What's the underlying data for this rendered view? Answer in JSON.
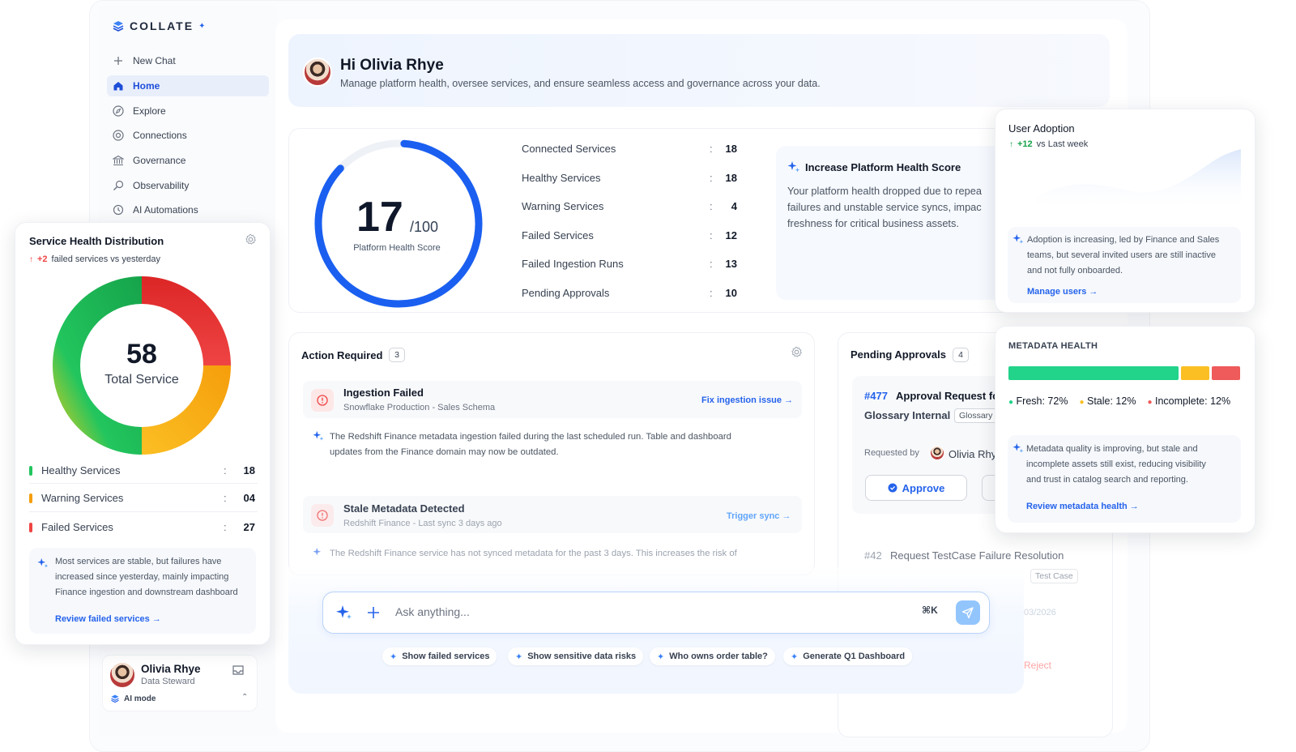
{
  "app": {
    "logo_text": "COLLATE"
  },
  "sidebar": {
    "items": [
      {
        "label": "New Chat",
        "icon": "plus-icon",
        "active": false
      },
      {
        "label": "Home",
        "icon": "home-icon",
        "active": true
      },
      {
        "label": "Explore",
        "icon": "compass-icon",
        "active": false
      },
      {
        "label": "Connections",
        "icon": "connections-icon",
        "active": false
      },
      {
        "label": "Governance",
        "icon": "governance-icon",
        "active": false
      },
      {
        "label": "Observability",
        "icon": "observability-icon",
        "active": false
      },
      {
        "label": "AI Automations",
        "icon": "automation-icon",
        "active": false
      }
    ],
    "user": {
      "name": "Olivia Rhye",
      "role": "Data Steward",
      "mode": "AI mode"
    }
  },
  "greeting": {
    "title": "Hi Olivia Rhye",
    "subtitle": "Manage platform health, oversee services, and ensure seamless access and governance across your data."
  },
  "platform_health": {
    "score": 17,
    "max_label": "/100",
    "label": "Platform Health Score",
    "stats": [
      {
        "label": "Connected Services",
        "value": "18"
      },
      {
        "label": "Healthy Services",
        "value": "18"
      },
      {
        "label": "Warning Services",
        "value": "4"
      },
      {
        "label": "Failed Services",
        "value": "12"
      },
      {
        "label": "Failed Ingestion Runs",
        "value": "13"
      },
      {
        "label": "Pending Approvals",
        "value": "10"
      }
    ],
    "insight": {
      "title": "Increase Platform Health Score",
      "lines": [
        "Your platform health dropped due to repea",
        "failures and unstable service syncs, impac",
        "freshness for critical business assets."
      ]
    }
  },
  "service_health": {
    "title": "Service Health Distribution",
    "delta": "+2",
    "delta_text": "failed services vs yesterday",
    "total": "58",
    "total_label": "Total Service",
    "segments": [
      {
        "label": "Healthy Services",
        "value": "18",
        "color": "#22c55e"
      },
      {
        "label": "Warning Services",
        "value": "04",
        "color": "#f59e0b"
      },
      {
        "label": "Failed Services",
        "value": "27",
        "color": "#ef4444"
      }
    ],
    "note_lines": [
      "Most services are stable, but failures have",
      "increased since yesterday, mainly impacting",
      "Finance ingestion and downstream dashboard"
    ],
    "link": "Review failed services →"
  },
  "user_adoption": {
    "title": "User Adoption",
    "delta": "+12",
    "delta_text": "vs Last week",
    "note_lines": [
      "Adoption is increasing, led by Finance and Sales",
      "teams, but several invited users are still inactive",
      "and not fully onboarded."
    ],
    "link": "Manage users →"
  },
  "metadata_health": {
    "title": "METADATA HEALTH",
    "fresh": 0.72,
    "stale": 0.12,
    "incomplete": 0.12,
    "fresh_label": "Fresh: 72%",
    "stale_label": "Stale: 12%",
    "incomplete_label": "Incomplete: 12%",
    "colors": {
      "fresh": "#22d38a",
      "stale": "#fbbf24",
      "incomplete": "#ef5a5a"
    },
    "note_lines": [
      "Metadata quality is improving, but stale and",
      "incomplete assets still exist, reducing visibility",
      "and trust in catalog search and reporting."
    ],
    "link": "Review metadata health →"
  },
  "actions": {
    "title": "Action Required",
    "count": "3",
    "items": [
      {
        "title": "Ingestion Failed",
        "sub": "Snowflake Production - Sales Schema",
        "link": "Fix ingestion issue →",
        "body_lines": [
          "The Redshift Finance metadata ingestion failed during the last scheduled run. Table and dashboard",
          "updates from the Finance domain may now be outdated."
        ]
      },
      {
        "title": "Stale Metadata Detected",
        "sub": "Redshift Finance - Last sync 3 days ago",
        "link": "Trigger sync →",
        "body_lines": [
          "The Redshift Finance service has not synced metadata for the past 3 days. This increases the risk of"
        ]
      }
    ]
  },
  "pending": {
    "title": "Pending Approvals",
    "count": "4",
    "request1": {
      "id": "#477",
      "title": "Approval Request fo",
      "subtitle": "Glossary Internal",
      "tag": "Glossary",
      "requested_by_label": "Requested by",
      "requester": "Olivia Rhy",
      "approve": "Approve"
    },
    "request2": {
      "id": "#42",
      "title": "Request TestCase Failure Resolution",
      "tag": "Test Case",
      "date": "03/2026",
      "reject": "Reject"
    }
  },
  "ask": {
    "placeholder": "Ask anything...",
    "shortcut": "⌘K",
    "suggestions": [
      "Show failed services",
      "Show sensitive data risks",
      "Who owns order table?",
      "Generate Q1 Dashboard"
    ]
  }
}
